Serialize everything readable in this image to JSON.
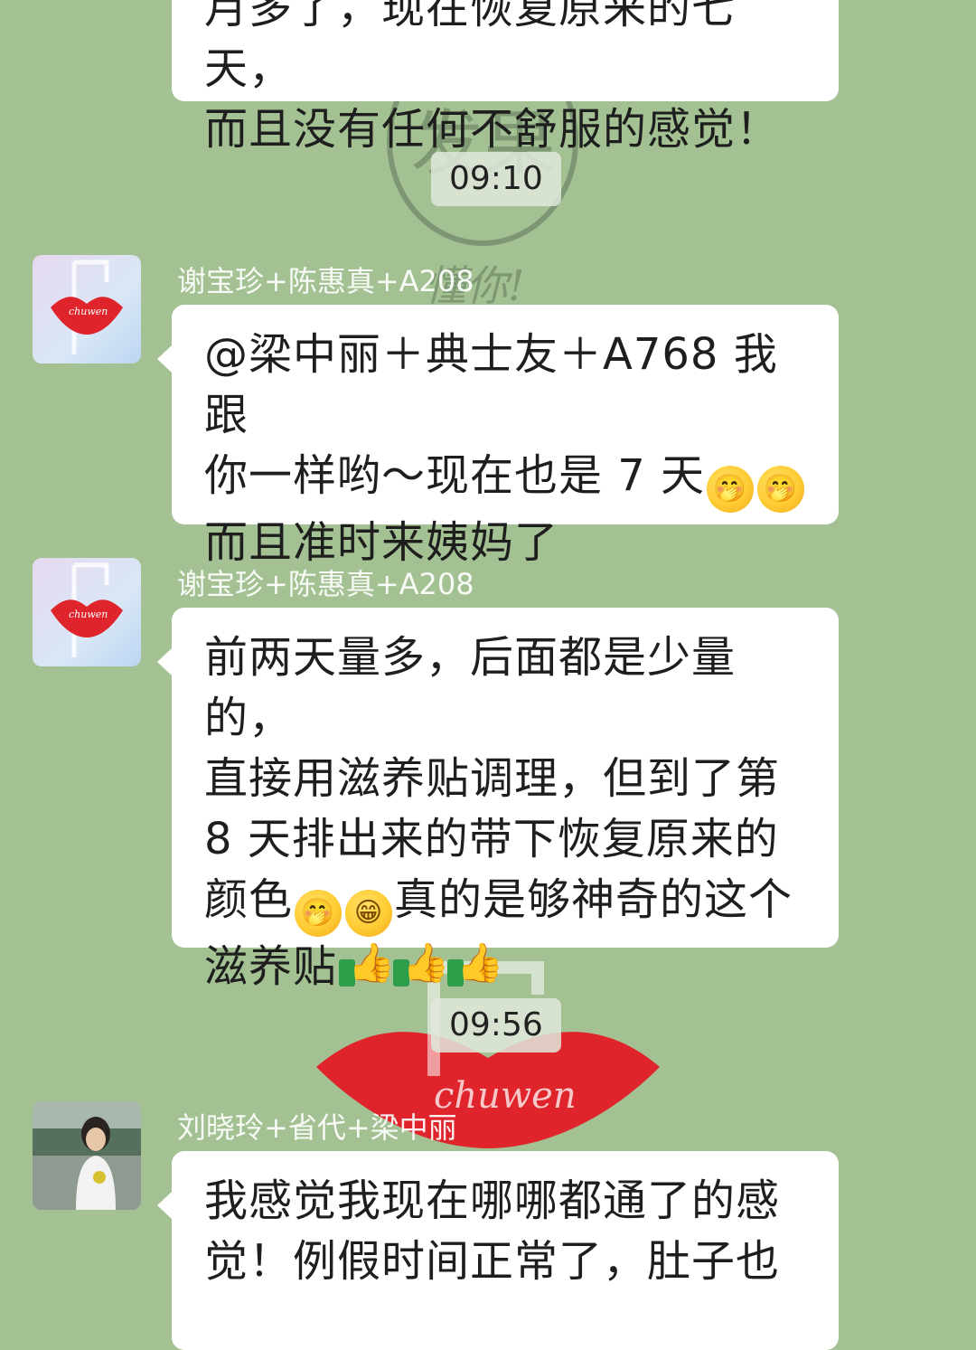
{
  "messages": [
    {
      "sender": "",
      "text_lines": [
        "月多了，现在恢复原来的七天，",
        "而且没有任何不舒服的感觉！"
      ]
    },
    {
      "sender": "谢宝珍+陈惠真+A208",
      "avatar": "chuwen-brand-avatar",
      "text_lines": [
        "@梁中丽＋典士友＋A768 我跟",
        "你一样哟～现在也是 7 天",
        "而且准时来姨妈了"
      ],
      "emojis": [
        "thinking-emoji",
        "thinking-emoji"
      ]
    },
    {
      "sender": "谢宝珍+陈惠真+A208",
      "avatar": "chuwen-brand-avatar",
      "text_lines": [
        "前两天量多，后面都是少量的，",
        "直接用滋养贴调理，但到了第",
        "8 天排出来的带下恢复原来的",
        "颜色",
        "真的是够神奇的这个",
        "滋养贴"
      ],
      "emojis": [
        "thinking-emoji",
        "grin-emoji",
        "thumbs-up-icon",
        "thumbs-up-icon",
        "thumbs-up-icon"
      ]
    },
    {
      "sender": "刘晓玲+省代+梁中丽",
      "avatar": "user-photo-avatar",
      "text_lines": [
        "我感觉我现在哪哪都通了的感",
        "觉！例假时间正常了，肚子也"
      ]
    }
  ],
  "timestamps": [
    "09:10",
    "09:56"
  ],
  "avatar_brand_text": "chuwen",
  "colors": {
    "chat_background": "#a3c192",
    "bubble": "#ffffff",
    "lips_red": "#e0242c"
  }
}
